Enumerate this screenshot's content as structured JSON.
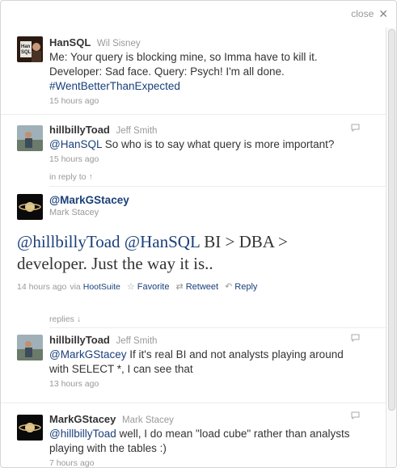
{
  "close": {
    "label": "close",
    "icon": "close-icon"
  },
  "tweets": [
    {
      "screen_name": "HanSQL",
      "full_name": "Wil Sisney",
      "text": "Me: Your query is blocking mine, so Imma have to kill it.",
      "text2": "Developer: Sad face. Query: Psych! I'm all done.",
      "hashtag": "#WentBetterThanExpected",
      "time": "15 hours ago",
      "avatar_text": "Han SQL"
    },
    {
      "screen_name": "hillbillyToad",
      "full_name": "Jeff Smith",
      "mention": "@HanSQL",
      "text": " So who is to say what query is more important?",
      "time": "15 hours ago"
    }
  ],
  "in_reply_to": "in reply to ↑",
  "focus": {
    "screen_name": "@MarkGStacey",
    "full_name": "Mark Stacey",
    "mention1": "@hillbillyToad",
    "mention2": "@HanSQL",
    "text_after": " BI > DBA >",
    "line2": "developer. Just the way it is..",
    "time": "14 hours ago",
    "via_label": "via",
    "via_app": "HootSuite",
    "favorite": "Favorite",
    "retweet": "Retweet",
    "reply": "Reply"
  },
  "replies_label": "replies ↓",
  "replies": [
    {
      "screen_name": "hillbillyToad",
      "full_name": "Jeff Smith",
      "mention": "@MarkGStacey",
      "text": " If it's real BI and not analysts playing around",
      "text2": "with SELECT *, I can see that",
      "time": "13 hours ago"
    },
    {
      "screen_name": "MarkGStacey",
      "full_name": "Mark Stacey",
      "mention": "@hillbillyToad",
      "text": " well, I do mean \"load cube\" rather than analysts",
      "text2": "playing with the tables :)",
      "time": "7 hours ago"
    }
  ]
}
